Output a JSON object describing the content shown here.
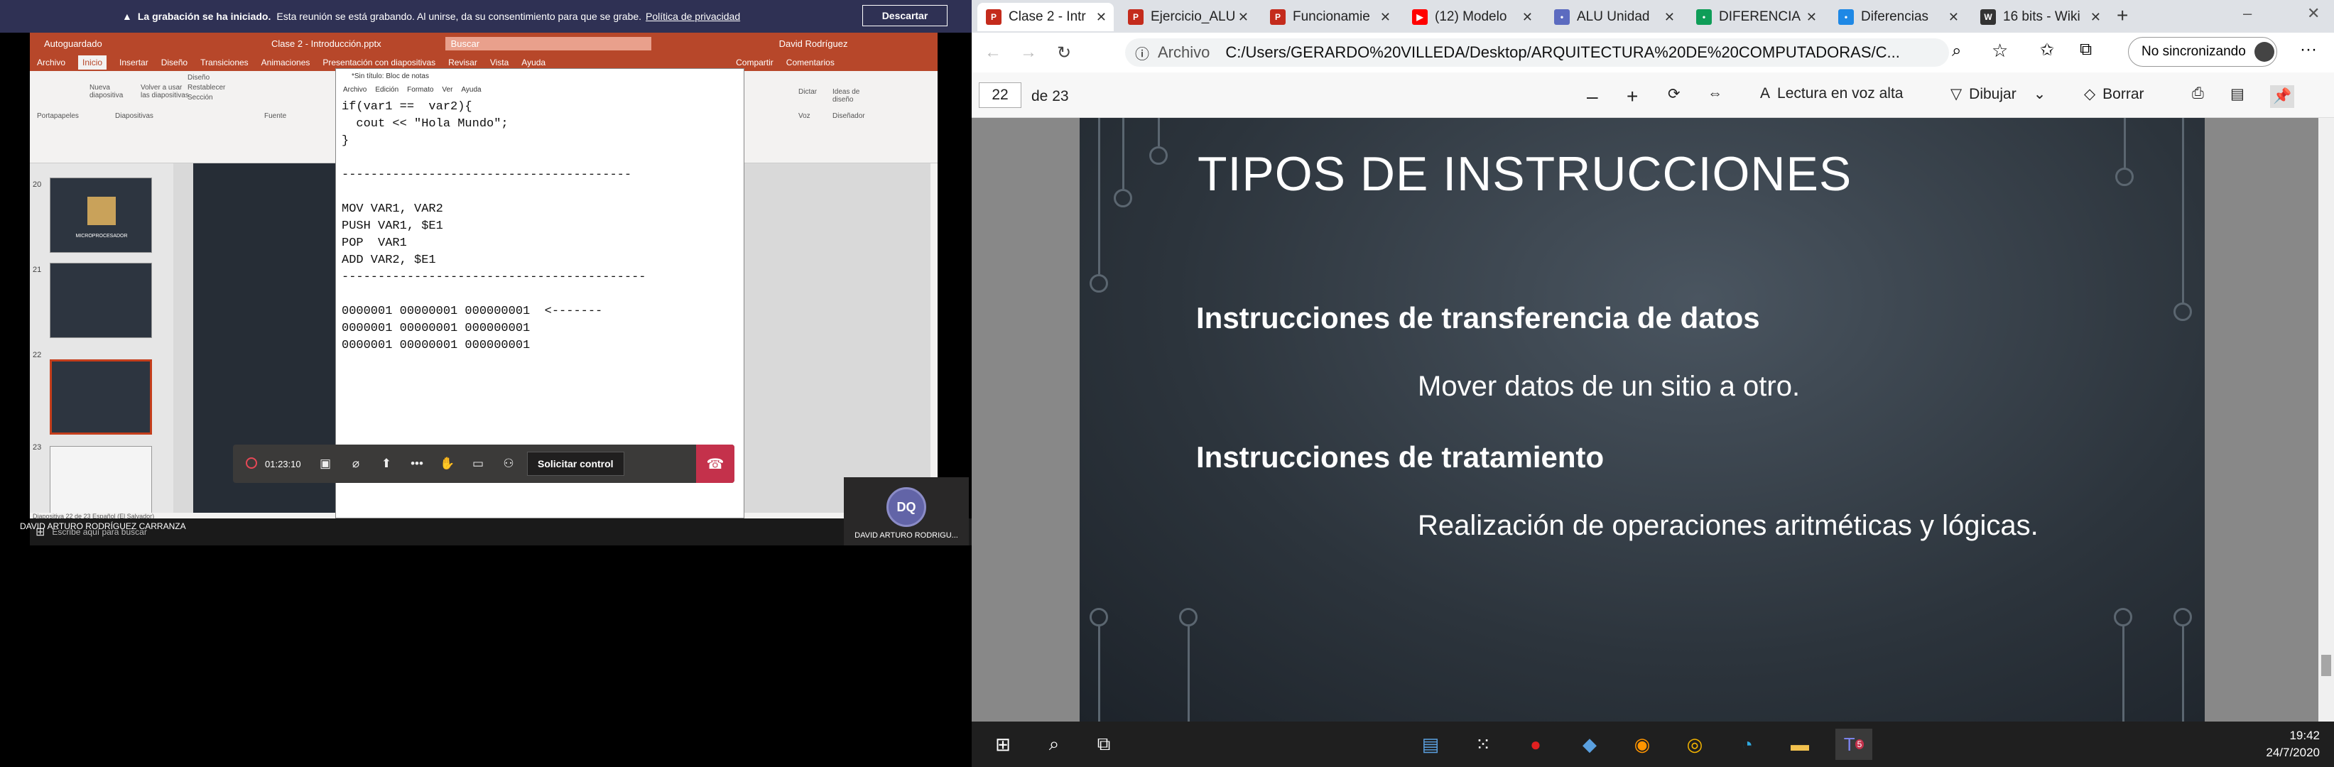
{
  "teams_banner": {
    "bold": "La grabación se ha iniciado.",
    "text": "Esta reunión se está grabando. Al unirse, da su consentimiento para que se grabe.",
    "link": "Política de privacidad",
    "button": "Descartar"
  },
  "shared_screen": {
    "ppt_title": "Clase 2 - Introducción.pptx",
    "ppt_search": "Buscar",
    "ppt_user": "David Rodríguez",
    "ppt_autosave": "Autoguardado",
    "tabs": [
      "Archivo",
      "Inicio",
      "Insertar",
      "Diseño",
      "Transiciones",
      "Animaciones",
      "Presentación con diapositivas",
      "Revisar",
      "Vista",
      "Ayuda"
    ],
    "share": "Compartir",
    "comments": "Comentarios",
    "ribbon_groups": [
      "Portapapeles",
      "Diapositivas",
      "Fuente",
      "Voz",
      "Diseñador"
    ],
    "ribbon_buttons": [
      "Nueva diapositiva",
      "Volver a usar las diapositivas",
      "Diseño",
      "Restablecer",
      "Sección",
      "Dictar",
      "Ideas de diseño"
    ],
    "slide_numbers": [
      "20",
      "21",
      "22",
      "23"
    ],
    "thumb_text": "MICROPROCESADOR",
    "status_bar": "Diapositiva 22 de 23    Español (El Salvador)",
    "notepad_title": "*Sin título: Bloc de notas",
    "notepad_menu": [
      "Archivo",
      "Edición",
      "Formato",
      "Ver",
      "Ayuda"
    ],
    "notepad_lines": [
      "if(var1 ==  var2){",
      "  cout << \"Hola Mundo\";",
      "}",
      "",
      "----------------------------------------",
      "",
      "MOV VAR1, VAR2",
      "PUSH VAR1, $E1",
      "POP  VAR1",
      "ADD VAR2, $E1",
      "------------------------------------------",
      "",
      "0000001 00000001 000000001  <-------",
      "0000001 00000001 000000001",
      "0000001 00000001 000000001"
    ],
    "teams_timer": "01:23:10",
    "request_control": "Solicitar control",
    "presenter": "DAVID ARTURO RODRÍGUEZ CARRANZA",
    "inner_search": "Escribe aquí para buscar",
    "avatar_initials": "DQ",
    "avatar_name": "DAVID ARTURO RODRIGU..."
  },
  "browser": {
    "tabs": [
      {
        "title": "Clase 2 - Intr",
        "icon": "pdf",
        "color": "#c42b1c"
      },
      {
        "title": "Ejercicio_ALU",
        "icon": "pdf",
        "color": "#c42b1c"
      },
      {
        "title": "Funcionamie",
        "icon": "pdf",
        "color": "#c42b1c"
      },
      {
        "title": "(12) Modelo",
        "icon": "youtube",
        "color": "#ff0000"
      },
      {
        "title": "ALU Unidad",
        "icon": "web",
        "color": "#5c6bc0"
      },
      {
        "title": "DIFERENCIA",
        "icon": "web",
        "color": "#0f9d58"
      },
      {
        "title": "Diferencias",
        "icon": "web",
        "color": "#1e88e5"
      },
      {
        "title": "16 bits - Wiki",
        "icon": "wiki",
        "color": "#333333"
      }
    ],
    "url_proto": "Archivo",
    "url": "C:/Users/GERARDO%20VILLEDA/Desktop/ARQUITECTURA%20DE%20COMPUTADORAS/C...",
    "sync": "No sincronizando",
    "page_current": "22",
    "page_total": "de 23",
    "read_aloud": "Lectura en voz alta",
    "draw": "Dibujar",
    "erase": "Borrar"
  },
  "slide": {
    "title": "TIPOS DE INSTRUCCIONES",
    "heading1": "Instrucciones de transferencia de datos",
    "sub1": "Mover datos de un sitio a otro.",
    "heading2": "Instrucciones de tratamiento",
    "sub2": "Realización de operaciones aritméticas y lógicas."
  },
  "taskbar": {
    "time": "19:42",
    "date": "24/7/2020",
    "teams_badge": "5"
  }
}
